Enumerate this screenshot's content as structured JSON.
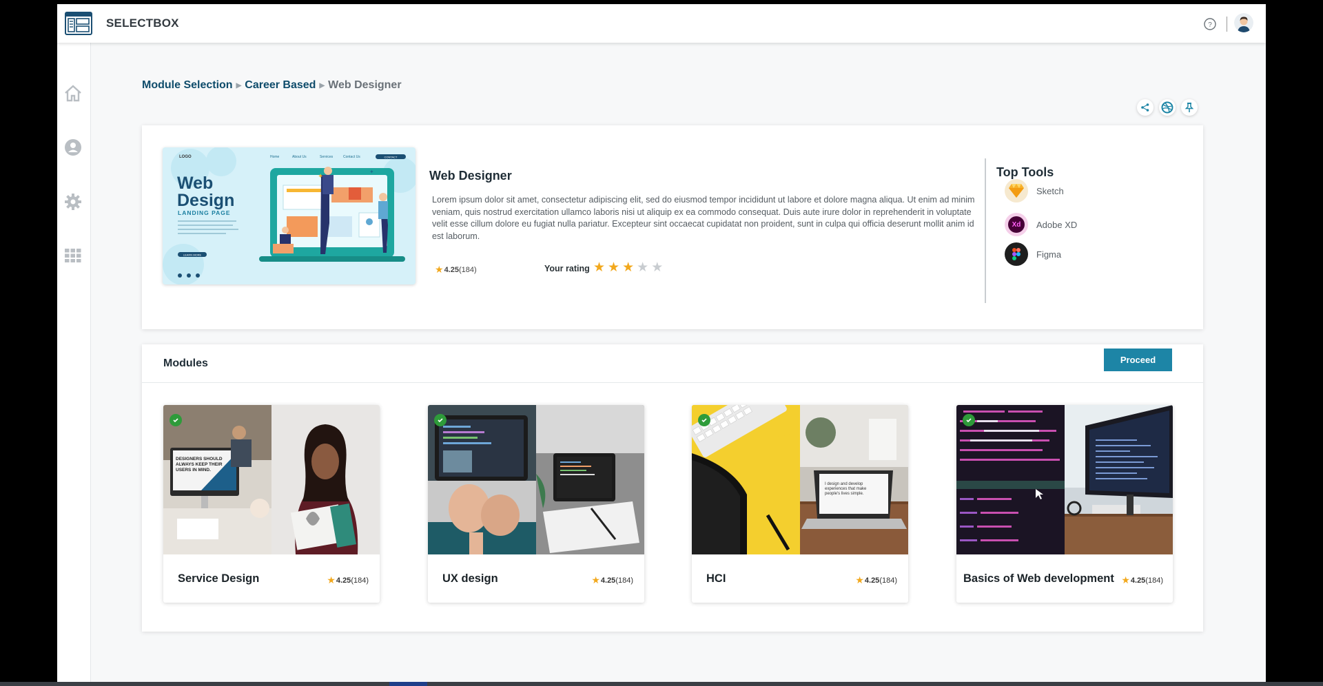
{
  "header": {
    "brand": "SELECTBOX",
    "help_icon": "question-circle-icon",
    "avatar_icon": "user-avatar-icon"
  },
  "sidebar": {
    "items": [
      {
        "icon": "home-icon"
      },
      {
        "icon": "profile-icon"
      },
      {
        "icon": "settings-icon"
      },
      {
        "icon": "apps-grid-icon"
      }
    ]
  },
  "breadcrumb": {
    "items": [
      "Module Selection",
      "Career Based"
    ],
    "current": "Web Designer"
  },
  "actions": [
    "share-icon",
    "dribbble-icon",
    "pin-icon"
  ],
  "career": {
    "title": "Web Designer",
    "description": "Lorem ipsum dolor sit amet, consectetur adipiscing elit, sed do eiusmod tempor incididunt ut labore et dolore magna aliqua. Ut enim ad minim veniam, quis nostrud exercitation ullamco laboris nisi ut aliquip ex ea commodo consequat. Duis aute irure dolor in reprehenderit in voluptate velit esse cillum dolore eu fugiat nulla pariatur. Excepteur sint occaecat cupidatat non proident, sunt in culpa qui officia deserunt mollit anim id est laborum.",
    "rating": "4.25",
    "rating_count": "(184)",
    "your_rating_label": "Your rating",
    "your_rating_value": 3,
    "your_rating_max": 5,
    "image": {
      "logo": "LOGO",
      "nav": [
        "Home",
        "About Us",
        "Services",
        "Contact Us"
      ],
      "cta": "CONTACT",
      "headline_1": "Web",
      "headline_2": "Design",
      "subline": "LANDING PAGE",
      "button": "LEARN MORE"
    }
  },
  "top_tools": {
    "title": "Top Tools",
    "items": [
      {
        "name": "Sketch",
        "icon": "sketch-icon"
      },
      {
        "name": "Adobe XD",
        "icon": "adobe-xd-icon",
        "badge": "Xd"
      },
      {
        "name": "Figma",
        "icon": "figma-icon"
      }
    ]
  },
  "modules": {
    "title": "Modules",
    "proceed_label": "Proceed",
    "items": [
      {
        "name": "Service Design",
        "rating": "4.25",
        "count": "(184)",
        "selected": true,
        "image_text": "DESIGNERS SHOULD ALWAYS KEEP THEIR USERS IN MIND."
      },
      {
        "name": "UX design",
        "rating": "4.25",
        "count": "(184)",
        "selected": true
      },
      {
        "name": "HCI",
        "rating": "4.25",
        "count": "(184)",
        "selected": true,
        "image_text": "I design and develop experiences that make people's lives simple."
      },
      {
        "name": "Basics of Web development",
        "rating": "4.25",
        "count": "(184)",
        "selected": true
      }
    ]
  },
  "colors": {
    "accent": "#1d85a6",
    "link": "#0f4c6b",
    "star": "#f2a81d",
    "star_empty": "#c8ccd0",
    "check": "#2e9b3a"
  }
}
